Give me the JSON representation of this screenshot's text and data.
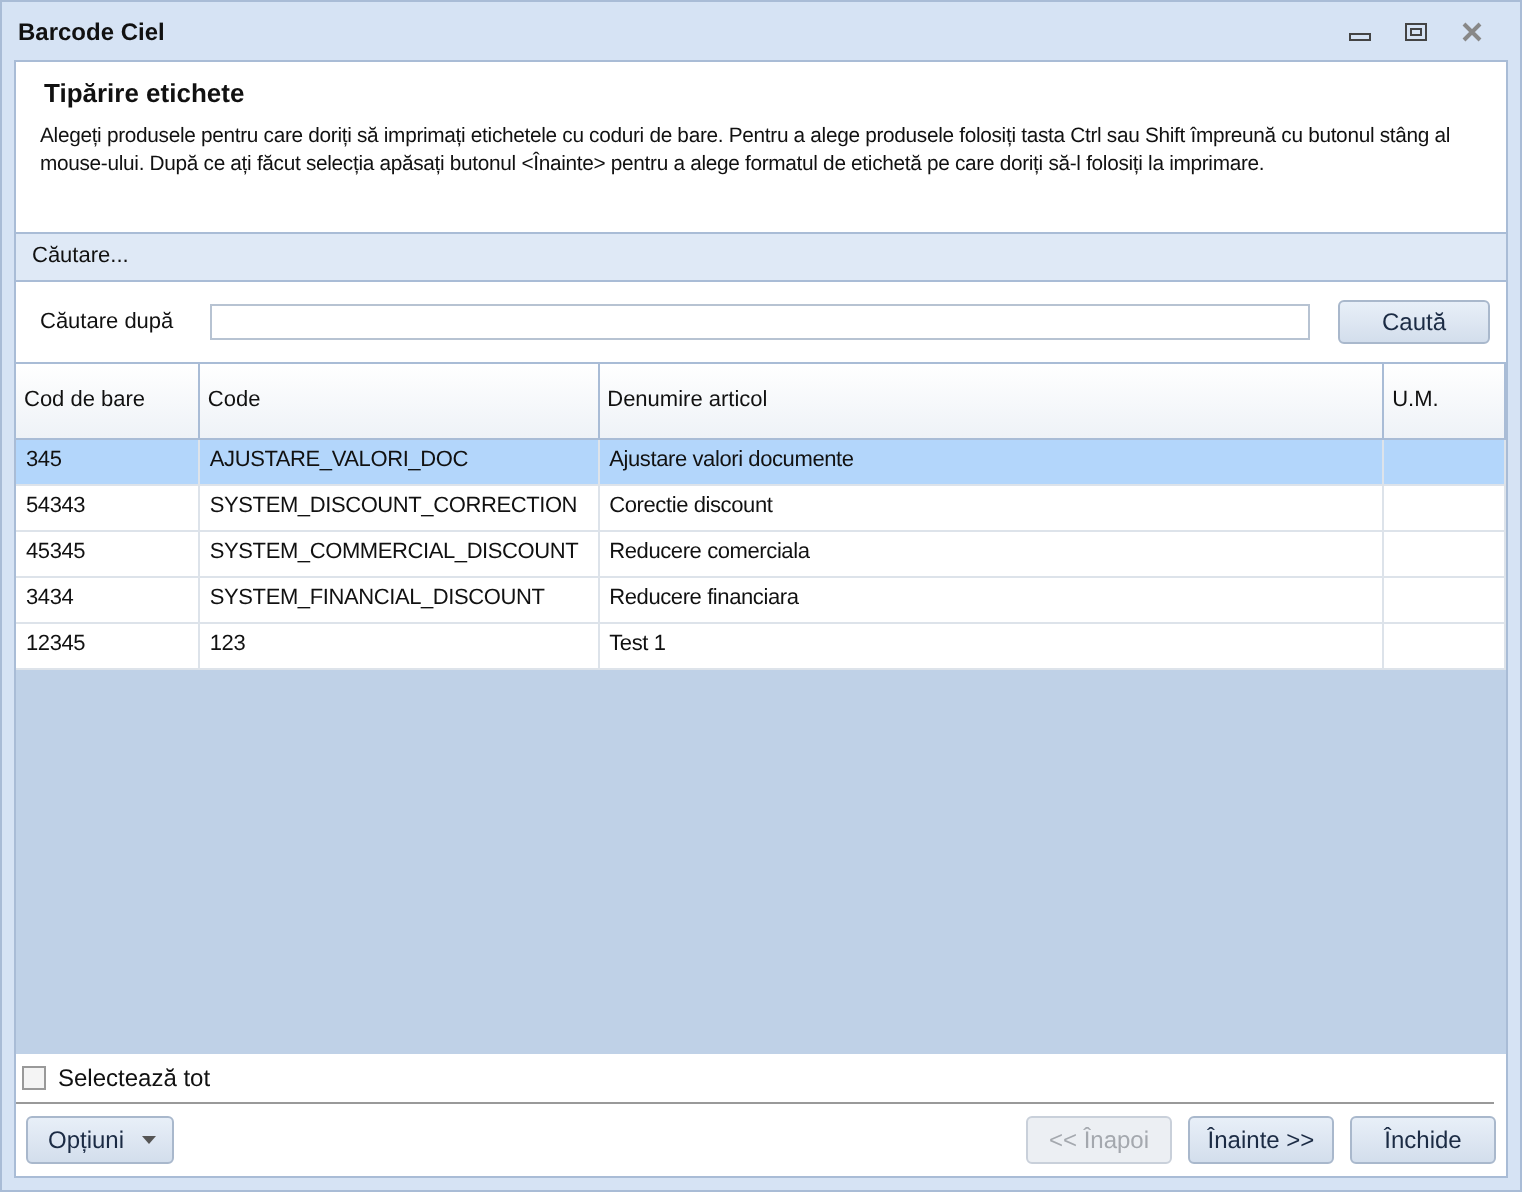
{
  "window": {
    "title": "Barcode Ciel"
  },
  "header": {
    "title": "Tipărire etichete",
    "description": "Alegeți produsele pentru care doriți să imprimați etichetele cu coduri de bare. Pentru a alege produsele folosiți tasta Ctrl sau Shift împreună cu butonul stâng al mouse-ului. După ce ați făcut selecția apăsați butonul <Înainte> pentru a alege formatul de etichetă pe care doriți să-l folosiți la imprimare."
  },
  "search_panel": {
    "title": "Căutare...",
    "label": "Căutare după",
    "button": "Caută"
  },
  "table": {
    "columns": [
      "Cod de bare",
      "Code",
      "Denumire articol",
      "U.M."
    ],
    "rows": [
      {
        "cells": [
          "345",
          "AJUSTARE_VALORI_DOC",
          "Ajustare valori documente",
          ""
        ],
        "selected": true
      },
      {
        "cells": [
          "54343",
          "SYSTEM_DISCOUNT_CORRECTION",
          "Corectie discount",
          ""
        ],
        "selected": false
      },
      {
        "cells": [
          "45345",
          "SYSTEM_COMMERCIAL_DISCOUNT",
          "Reducere comerciala",
          ""
        ],
        "selected": false
      },
      {
        "cells": [
          "3434",
          "SYSTEM_FINANCIAL_DISCOUNT",
          "Reducere financiara",
          ""
        ],
        "selected": false
      },
      {
        "cells": [
          "12345",
          "123",
          "Test 1",
          ""
        ],
        "selected": false
      }
    ]
  },
  "select_all": {
    "label": "Selectează tot",
    "checked": false
  },
  "footer": {
    "options": "Opțiuni",
    "buttons": [
      {
        "label": "<< Înapoi",
        "disabled": true
      },
      {
        "label": "Înainte >>",
        "disabled": false
      },
      {
        "label": "Închide",
        "disabled": false
      }
    ]
  }
}
